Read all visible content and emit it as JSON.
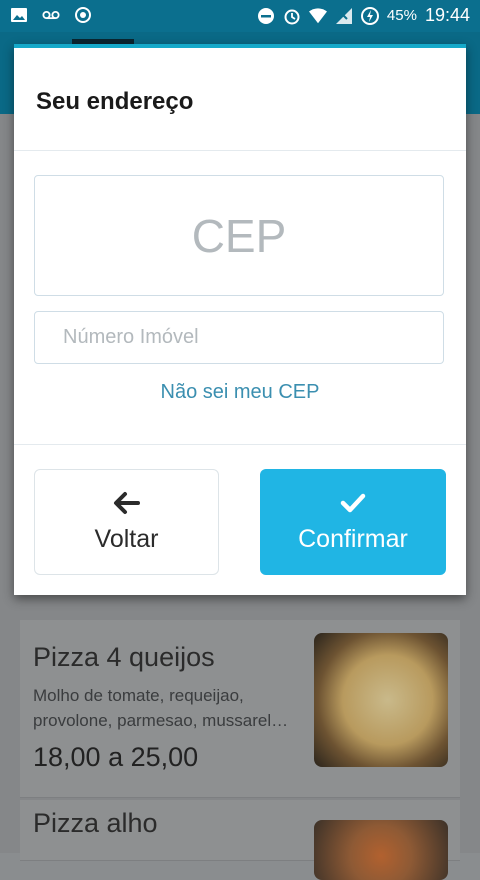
{
  "status_bar": {
    "battery": "45%",
    "time": "19:44",
    "icons": [
      "image-icon",
      "voicemail-icon",
      "sync-icon",
      "do-not-disturb-icon",
      "alarm-icon",
      "wifi-icon",
      "no-signal-icon",
      "battery-charging-icon"
    ]
  },
  "modal": {
    "title": "Seu endereço",
    "cep_placeholder": "CEP",
    "numero_placeholder": "Número Imóvel",
    "nao_sei_link": "Não sei meu CEP",
    "back_label": "Voltar",
    "confirm_label": "Confirmar",
    "back_icon": "arrow-left-icon",
    "confirm_icon": "check-icon"
  },
  "menu": {
    "items": [
      {
        "title": "Pizza 4 queijos",
        "description_lines": [
          "Molho de tomate, requeijao,",
          "provolone, parmesao, mussarel…"
        ],
        "price": "18,00 a 25,00"
      },
      {
        "title": "Pizza alho"
      }
    ]
  },
  "colors": {
    "accent": "#20b5e4",
    "link": "#3b8fb0",
    "status_bar": "#0b6f8e"
  }
}
